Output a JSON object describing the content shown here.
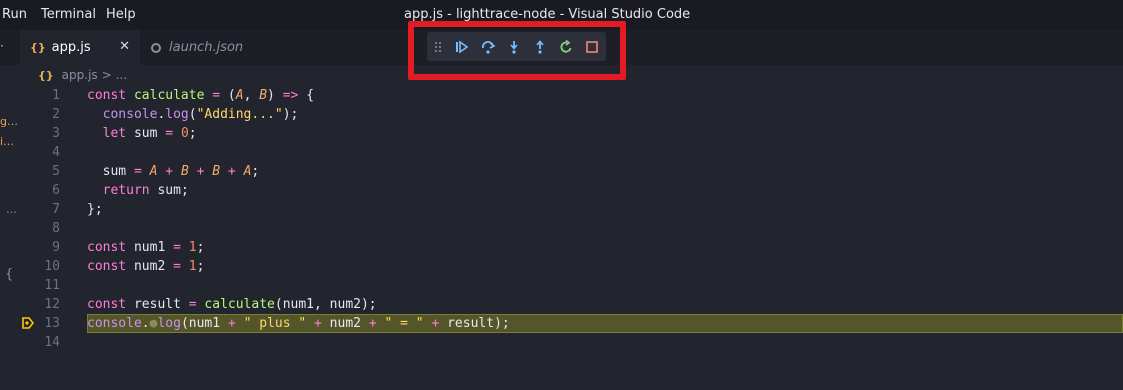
{
  "menu": {
    "run": "Run",
    "terminal": "Terminal",
    "help": "Help"
  },
  "window_title": "app.js - lighttrace-node - Visual Studio Code",
  "tabs": [
    {
      "label": "app.js",
      "icon": "js-icon",
      "active": true
    },
    {
      "label": "launch.json",
      "icon": "json-icon",
      "active": false
    }
  ],
  "breadcrumb": {
    "file": "app.js",
    "sep": ">",
    "more": "..."
  },
  "sidebar_fragments": [
    "g…",
    "i…",
    "…",
    "{"
  ],
  "debug_toolbar": {
    "buttons": [
      "drag-handle",
      "continue",
      "step-over",
      "step-into",
      "step-out",
      "restart",
      "stop"
    ]
  },
  "editor": {
    "current_line": 13,
    "line_numbers": [
      "1",
      "2",
      "3",
      "4",
      "5",
      "6",
      "7",
      "8",
      "9",
      "10",
      "11",
      "12",
      "13",
      "14"
    ]
  },
  "colors": {
    "accent_red": "#e31b23",
    "highlight": "#545629"
  }
}
